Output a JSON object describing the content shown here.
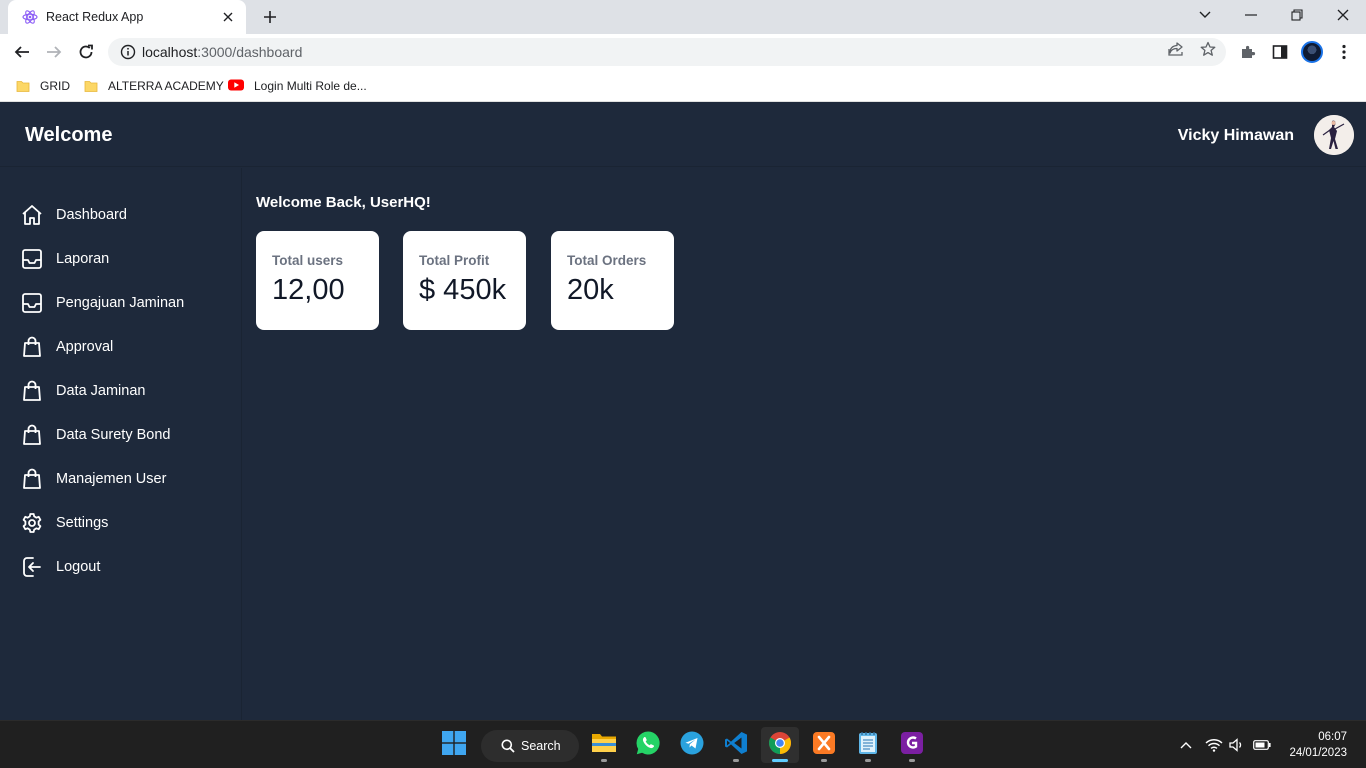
{
  "browser": {
    "tab_title": "React Redux App",
    "url_host": "localhost",
    "url_rest": ":3000/dashboard",
    "bookmarks": [
      {
        "label": "GRID",
        "icon": "folder-icon"
      },
      {
        "label": "ALTERRA ACADEMY",
        "icon": "folder-icon"
      },
      {
        "label": "Login Multi Role de...",
        "icon": "youtube-icon"
      }
    ]
  },
  "header": {
    "brand": "Welcome",
    "user_name": "Vicky Himawan"
  },
  "sidebar": {
    "items": [
      {
        "label": "Dashboard",
        "icon": "home-icon"
      },
      {
        "label": "Laporan",
        "icon": "inbox-icon"
      },
      {
        "label": "Pengajuan Jaminan",
        "icon": "inbox-icon"
      },
      {
        "label": "Approval",
        "icon": "shopping-bag-icon"
      },
      {
        "label": "Data Jaminan",
        "icon": "shopping-bag-icon"
      },
      {
        "label": "Data Surety Bond",
        "icon": "shopping-bag-icon"
      },
      {
        "label": "Manajemen User",
        "icon": "shopping-bag-icon"
      },
      {
        "label": "Settings",
        "icon": "gear-icon"
      },
      {
        "label": "Logout",
        "icon": "logout-icon"
      }
    ]
  },
  "main": {
    "greeting": "Welcome Back, UserHQ!",
    "stats": [
      {
        "title": "Total users",
        "value": "12,00"
      },
      {
        "title": "Total Profit",
        "value": "$ 450k"
      },
      {
        "title": "Total Orders",
        "value": "20k"
      }
    ]
  },
  "taskbar": {
    "search_label": "Search",
    "time": "06:07",
    "date": "24/01/2023"
  },
  "colors": {
    "app_background": "#1e293b",
    "card_background": "#ffffff",
    "taskbar": "#202020"
  }
}
